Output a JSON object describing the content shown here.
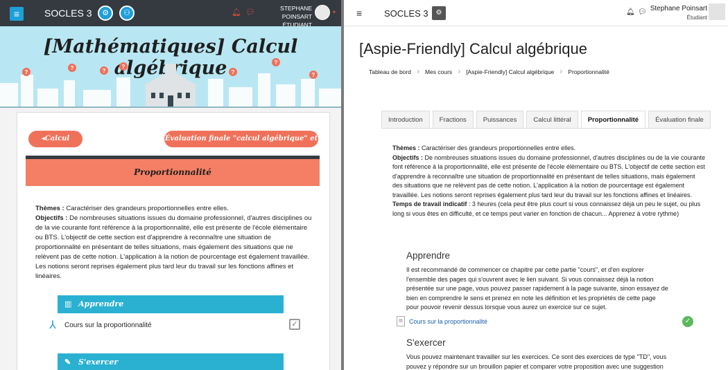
{
  "left": {
    "brand": "SOCLES 3",
    "user_name": "STEPHANE POINSART",
    "user_role": "ÉTUDIANT",
    "course_title": "[Mathématiques] Calcul algébrique",
    "prev_link": "◂Calcul littéral",
    "next_link": "Évaluation finale \"calcul algébrique\" et crédits▸",
    "section_title": "Proportionnalité",
    "themes_label": "Thèmes :",
    "themes_text": " Caractériser  des grandeurs proportionnelles entre elles.",
    "objectifs_label": "Objectifs :",
    "objectifs_text": " De nombreuses situations issues du domaine professionnel, d'autres disciplines ou de la vie courante font référence à la proportionnalité, elle est présente de l'école élémentaire ou BTS.  L'objectif de cette section est d'apprendre à reconnaître  une situation de proportionnalité en présentant de telles situations, mais également des situations que ne relèvent  pas de cette notion.  L'application à la notion de pourcentage est également travaillée. Les notions seront reprises également plus tard leur du travail sur les fonctions affines et linéaires.",
    "apprendre_label": "Apprendre",
    "resource_label": "Cours sur la proportionnalité",
    "sexercer_label": "S'exercer",
    "colors": {
      "nav": "#343a40",
      "accent": "#f0715a",
      "bar": "#2ab1d2",
      "banner": "#b8e7f3"
    }
  },
  "right": {
    "brand": "SOCLES 3",
    "user_name": "Stephane Poinsart",
    "user_role": "Étudiant",
    "course_title": "[Aspie-Friendly] Calcul algébrique",
    "breadcrumbs": [
      "Tableau de bord",
      "Mes cours",
      "[Aspie-Friendly] Calcul algébrique",
      "Proportionnalité"
    ],
    "tabs": [
      "Introduction",
      "Fractions",
      "Puissances",
      "Calcul littéral",
      "Proportionnalité",
      "Évaluation finale"
    ],
    "active_tab": "Proportionnalité",
    "themes_label": "Thèmes :",
    "themes_text": " Caractériser des grandeurs proportionnelles entre elles.",
    "objectifs_label": "Objectifs :",
    "objectifs_text": " De nombreuses situations issues du domaine professionnel, d'autres disciplines ou de la vie courante font référence à la proportionnalité, elle est présente de l'école élémentaire ou BTS.  L'objectif de cette section est d'apprendre à reconnaître  une situation de proportionnalité en présentant de telles situations, mais également des situations que ne relèvent  pas de cette notion. L'application à la notion de pourcentage est également travaillée. Les notions seront reprises également plus tard leur du travail sur les fonctions affines et linéaires.",
    "temps_label": "Temps de travail indicatif",
    "temps_text": " : 3 heures (cela peut être plus court si vous connaissez déjà un peu le sujet, ou plus long si vous êtes en difficulté, et ce temps peut varier en fonction de chacun... Apprenez à votre rythme)",
    "apprendre_title": "Apprendre",
    "apprendre_text": "Il est recommandé de commencer ce chapitre par cette partie \"cours\", et d'en explorer l'ensemble des pages qui s'ouvrent avec le lien suivant. Si vous connaissez déjà la notion présentée sur une page, vous pouvez passer rapidement à la page suivante, sinon essayez de bien en comprendre le sens et prenez en note les définition et les propriétés de cette page pour pouvoir revenir dessus lorsque vous aurez un exercice sur ce sujet.",
    "resource_label": "Cours sur la proportionnalité",
    "sexercer_title": "S'exercer",
    "sexercer_text": "Vous pouvez maintenant travailler sur les exercices. Ce sont des exercices de type \"TD\", vous pouvez y répondre sur un brouillon papier et comparer votre proposition avec une suggestion",
    "colors": {
      "done": "#5cb85c",
      "link": "#1b5fa8"
    }
  }
}
